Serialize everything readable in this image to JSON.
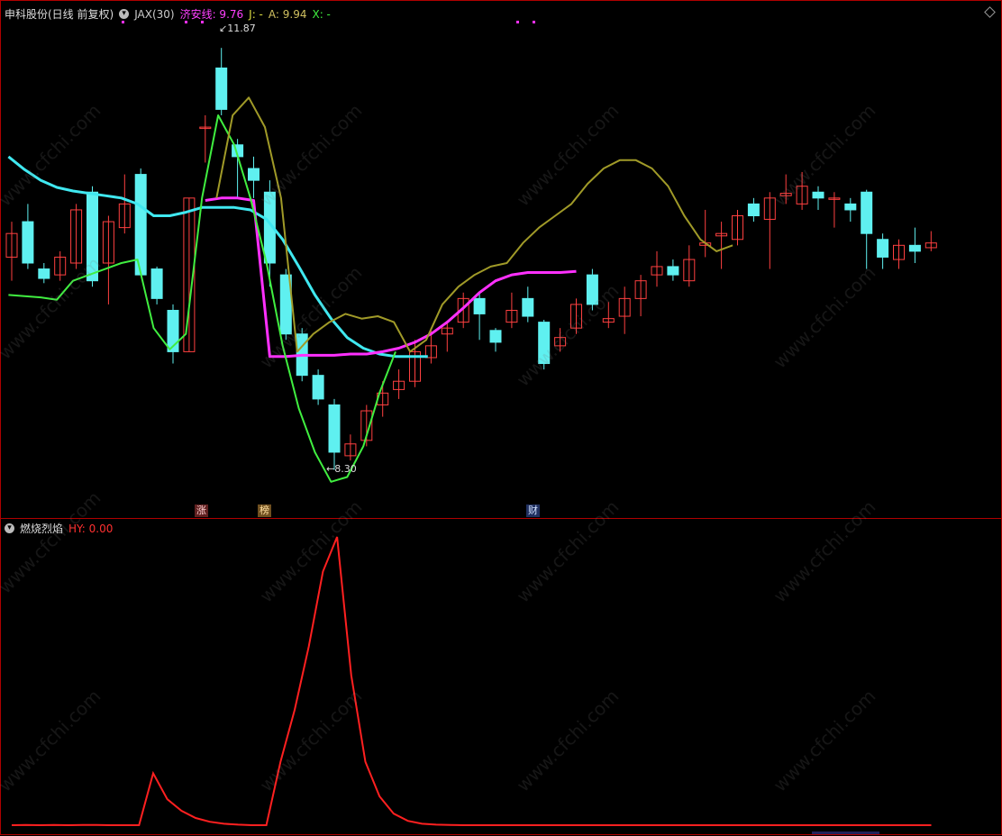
{
  "header": {
    "stock": "申科股份(日线 前复权)",
    "indicator": "JAX(30)",
    "jx_label": "济安线: 9.76",
    "j_label": "J: -",
    "a_label": "A: 9.94",
    "x_label": "X: -"
  },
  "labels": {
    "high": "11.87",
    "low": "8.30"
  },
  "tags": {
    "zhang": "涨",
    "bang": "榜",
    "cai": "财"
  },
  "sub": {
    "name": "燃烧烈焰",
    "hy": "HY: 0.00"
  },
  "watermark": "www.cfchi.com",
  "colors": {
    "up": "#ff4040",
    "down": "#5ff0f0",
    "magenta": "#ff30ff",
    "green": "#40ee40",
    "olive": "#a09a28",
    "cyan": "#40e8f0",
    "red": "#ff2020"
  },
  "candles": [
    {
      "o": 10.1,
      "c": 10.3,
      "h": 10.4,
      "l": 9.9
    },
    {
      "o": 10.4,
      "c": 10.05,
      "h": 10.55,
      "l": 10.0
    },
    {
      "o": 10.0,
      "c": 9.92,
      "h": 10.05,
      "l": 9.88
    },
    {
      "o": 9.95,
      "c": 10.1,
      "h": 10.15,
      "l": 9.9
    },
    {
      "o": 10.05,
      "c": 10.5,
      "h": 10.55,
      "l": 10.0
    },
    {
      "o": 10.65,
      "c": 9.9,
      "h": 10.7,
      "l": 9.85
    },
    {
      "o": 10.05,
      "c": 10.4,
      "h": 10.45,
      "l": 9.7
    },
    {
      "o": 10.35,
      "c": 10.55,
      "h": 10.8,
      "l": 10.3
    },
    {
      "o": 10.8,
      "c": 9.95,
      "h": 10.85,
      "l": 9.95
    },
    {
      "o": 10.0,
      "c": 9.75,
      "h": 10.02,
      "l": 9.7
    },
    {
      "o": 9.65,
      "c": 9.3,
      "h": 9.7,
      "l": 9.2
    },
    {
      "o": 9.3,
      "c": 10.6,
      "h": 10.6,
      "l": 9.3
    },
    {
      "o": 11.2,
      "c": 11.2,
      "h": 11.3,
      "l": 10.9
    },
    {
      "o": 11.7,
      "c": 11.35,
      "h": 11.87,
      "l": 11.3
    },
    {
      "o": 11.05,
      "c": 10.95,
      "h": 11.1,
      "l": 10.6
    },
    {
      "o": 10.85,
      "c": 10.75,
      "h": 10.95,
      "l": 10.6
    },
    {
      "o": 10.65,
      "c": 10.05,
      "h": 10.75,
      "l": 9.85
    },
    {
      "o": 9.95,
      "c": 9.45,
      "h": 10.0,
      "l": 9.4
    },
    {
      "o": 9.45,
      "c": 9.1,
      "h": 9.5,
      "l": 9.05
    },
    {
      "o": 9.1,
      "c": 8.9,
      "h": 9.15,
      "l": 8.85
    },
    {
      "o": 8.85,
      "c": 8.45,
      "h": 8.9,
      "l": 8.3
    },
    {
      "o": 8.42,
      "c": 8.52,
      "h": 8.6,
      "l": 8.38
    },
    {
      "o": 8.55,
      "c": 8.8,
      "h": 8.85,
      "l": 8.5
    },
    {
      "o": 8.85,
      "c": 8.95,
      "h": 9.05,
      "l": 8.75
    },
    {
      "o": 8.98,
      "c": 9.05,
      "h": 9.15,
      "l": 8.9
    },
    {
      "o": 9.05,
      "c": 9.3,
      "h": 9.4,
      "l": 9.0
    },
    {
      "o": 9.25,
      "c": 9.35,
      "h": 9.5,
      "l": 9.2
    },
    {
      "o": 9.45,
      "c": 9.5,
      "h": 9.55,
      "l": 9.3
    },
    {
      "o": 9.55,
      "c": 9.75,
      "h": 9.8,
      "l": 9.5
    },
    {
      "o": 9.75,
      "c": 9.62,
      "h": 9.8,
      "l": 9.4
    },
    {
      "o": 9.48,
      "c": 9.38,
      "h": 9.5,
      "l": 9.3
    },
    {
      "o": 9.55,
      "c": 9.65,
      "h": 9.8,
      "l": 9.5
    },
    {
      "o": 9.75,
      "c": 9.6,
      "h": 9.85,
      "l": 9.55
    },
    {
      "o": 9.55,
      "c": 9.2,
      "h": 9.57,
      "l": 9.15
    },
    {
      "o": 9.35,
      "c": 9.42,
      "h": 9.5,
      "l": 9.3
    },
    {
      "o": 9.5,
      "c": 9.7,
      "h": 9.75,
      "l": 9.45
    },
    {
      "o": 9.95,
      "c": 9.7,
      "h": 10.0,
      "l": 9.65
    },
    {
      "o": 9.55,
      "c": 9.58,
      "h": 9.72,
      "l": 9.5
    },
    {
      "o": 9.6,
      "c": 9.75,
      "h": 9.85,
      "l": 9.45
    },
    {
      "o": 9.75,
      "c": 9.9,
      "h": 9.95,
      "l": 9.6
    },
    {
      "o": 9.95,
      "c": 10.02,
      "h": 10.15,
      "l": 9.85
    },
    {
      "o": 10.02,
      "c": 9.95,
      "h": 10.08,
      "l": 9.9
    },
    {
      "o": 9.9,
      "c": 10.08,
      "h": 10.2,
      "l": 9.85
    },
    {
      "o": 10.2,
      "c": 10.22,
      "h": 10.5,
      "l": 10.1
    },
    {
      "o": 10.28,
      "c": 10.3,
      "h": 10.4,
      "l": 10.0
    },
    {
      "o": 10.25,
      "c": 10.45,
      "h": 10.5,
      "l": 10.2
    },
    {
      "o": 10.55,
      "c": 10.45,
      "h": 10.6,
      "l": 10.4
    },
    {
      "o": 10.42,
      "c": 10.6,
      "h": 10.65,
      "l": 10.0
    },
    {
      "o": 10.62,
      "c": 10.64,
      "h": 10.8,
      "l": 10.55
    },
    {
      "o": 10.55,
      "c": 10.7,
      "h": 10.82,
      "l": 10.5
    },
    {
      "o": 10.65,
      "c": 10.6,
      "h": 10.7,
      "l": 10.5
    },
    {
      "o": 10.6,
      "c": 10.6,
      "h": 10.65,
      "l": 10.35
    },
    {
      "o": 10.55,
      "c": 10.5,
      "h": 10.6,
      "l": 10.4
    },
    {
      "o": 10.65,
      "c": 10.3,
      "h": 10.67,
      "l": 10.0
    },
    {
      "o": 10.25,
      "c": 10.1,
      "h": 10.3,
      "l": 10.0
    },
    {
      "o": 10.08,
      "c": 10.2,
      "h": 10.25,
      "l": 10.0
    },
    {
      "o": 10.2,
      "c": 10.15,
      "h": 10.35,
      "l": 10.05
    },
    {
      "o": 10.18,
      "c": 10.22,
      "h": 10.32,
      "l": 10.15
    }
  ],
  "lines": {
    "cyan": [
      10.95,
      10.84,
      10.75,
      10.69,
      10.66,
      10.64,
      10.62,
      10.6,
      10.55,
      10.45,
      10.45,
      10.48,
      10.52,
      10.52,
      10.52,
      10.5,
      10.42,
      10.25,
      10.02,
      9.78,
      9.58,
      9.42,
      9.33,
      9.28,
      9.26,
      9.26,
      9.26
    ],
    "magenta": [
      10.58,
      10.6,
      10.6,
      10.58,
      9.26,
      9.26,
      9.27,
      9.27,
      9.27,
      9.28,
      9.28,
      9.3,
      9.33,
      9.38,
      9.45,
      9.55,
      9.67,
      9.8,
      9.9,
      9.95,
      9.97,
      9.97,
      9.97,
      9.98
    ],
    "green": [
      9.78,
      9.77,
      9.76,
      9.74,
      9.9,
      9.95,
      10.0,
      10.05,
      10.08,
      9.5,
      9.32,
      9.45,
      10.6,
      11.3,
      11.05,
      10.6,
      10.05,
      9.35,
      8.82,
      8.45,
      8.2,
      8.24,
      8.5,
      8.95,
      9.3
    ],
    "olive": [
      10.6,
      11.3,
      11.45,
      11.2,
      10.6,
      9.3,
      9.45,
      9.55,
      9.62,
      9.58,
      9.6,
      9.55,
      9.3,
      9.4,
      9.7,
      9.85,
      9.95,
      10.02,
      10.05,
      10.22,
      10.35,
      10.45,
      10.55,
      10.72,
      10.85,
      10.92,
      10.92,
      10.85,
      10.7,
      10.45,
      10.25,
      10.15,
      10.2
    ]
  },
  "hy_values": [
    0,
    0.1,
    0,
    0.1,
    0,
    0.1,
    0.05,
    0,
    0,
    0,
    18,
    9,
    5,
    2.5,
    1.2,
    0.5,
    0.2,
    0,
    0,
    22,
    40,
    62,
    88,
    100,
    52,
    22,
    10,
    4,
    1.5,
    0.5,
    0.2,
    0.05,
    0,
    0,
    0,
    0,
    0,
    0,
    0,
    0,
    0,
    0,
    0,
    0,
    0,
    0,
    0,
    0,
    0,
    0,
    0,
    0,
    0,
    0,
    0,
    0,
    0,
    0,
    0,
    0,
    0,
    0,
    0,
    0,
    0,
    0
  ]
}
